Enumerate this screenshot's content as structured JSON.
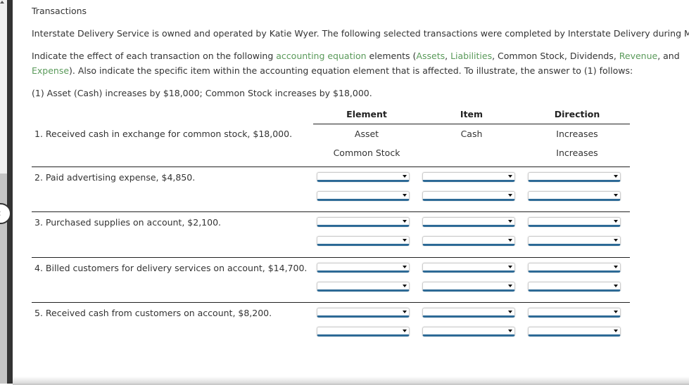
{
  "section_title": "Transactions",
  "intro": "Interstate Delivery Service is owned and operated by Katie Wyer. The following selected transactions were completed by Interstate Delivery during May:",
  "instruction": {
    "p1": "Indicate the effect of each transaction on the following ",
    "link_accounting_equation": "accounting equation",
    "p2": " elements (",
    "link_assets": "Assets",
    "sep1": ", ",
    "link_liabilities": "Liabilities",
    "p3": ", Common Stock, Dividends, ",
    "link_revenue": "Revenue",
    "p4": ", and",
    "link_expense": "Expense",
    "p5": "). Also indicate the specific item within the accounting equation element that is affected. To illustrate, the answer to (1) follows:"
  },
  "example": "(1) Asset (Cash) increases by $18,000; Common Stock increases by $18,000.",
  "columns": [
    "Element",
    "Item",
    "Direction"
  ],
  "example_row": {
    "label": "1.  Received cash in exchange for common stock, $18,000.",
    "lines": [
      {
        "element": "Asset",
        "item": "Cash",
        "direction": "Increases"
      },
      {
        "element": "Common Stock",
        "item": "",
        "direction": "Increases"
      }
    ]
  },
  "transactions": [
    {
      "label": "2.  Paid advertising expense, $4,850."
    },
    {
      "label": "3.  Purchased supplies on account, $2,100."
    },
    {
      "label": "4.  Billed customers for delivery services on account, $14,700."
    },
    {
      "label": "5.  Received cash from customers on account, $8,200."
    }
  ],
  "dropdown_values": "",
  "colors": {
    "link_green": "#5a9a5a",
    "select_underline": "#2d6a96"
  }
}
